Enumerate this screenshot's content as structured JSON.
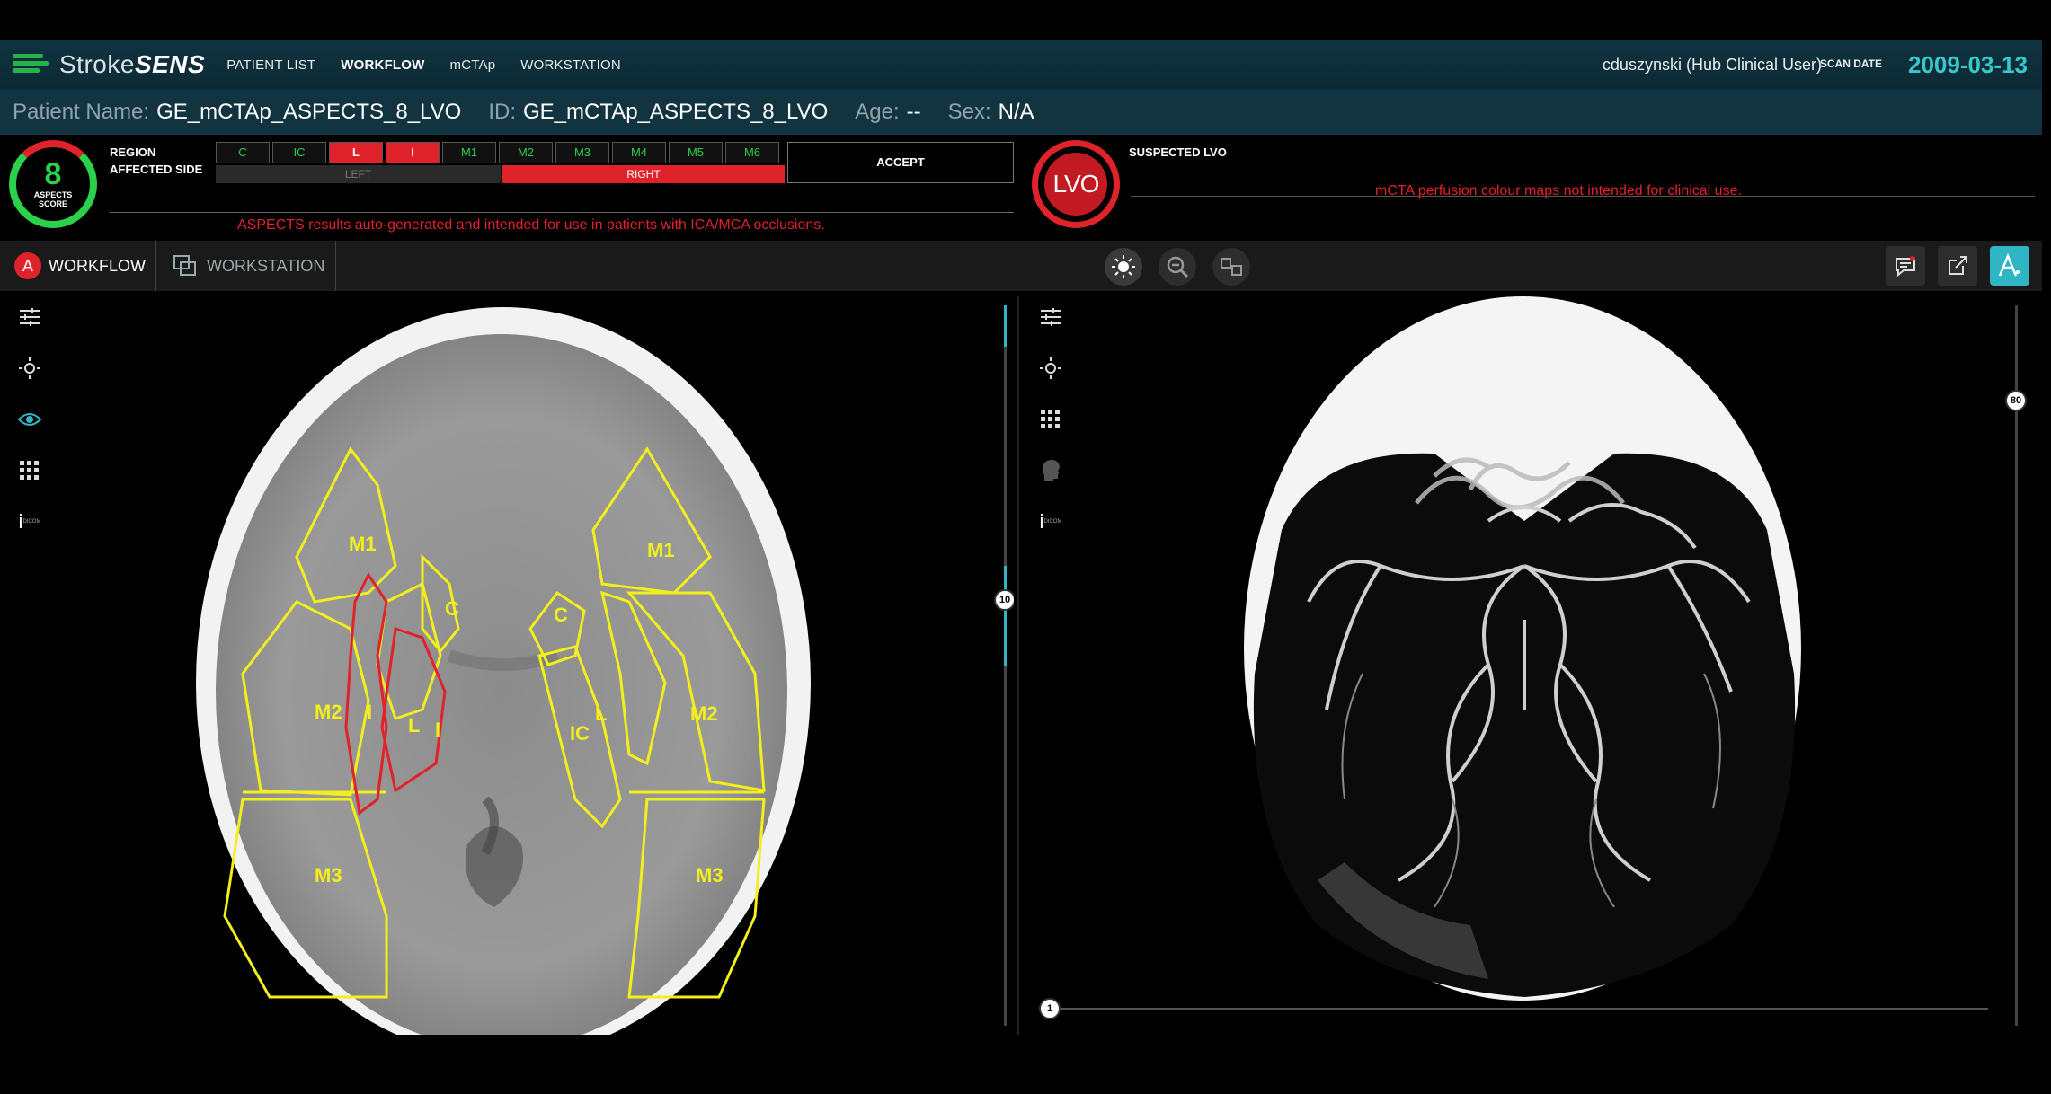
{
  "app": {
    "logo_prefix": "Stroke",
    "logo_suffix": "SENS",
    "nav": [
      "PATIENT LIST",
      "WORKFLOW",
      "mCTAp",
      "WORKSTATION"
    ],
    "user": "cduszynski (Hub Clinical User)",
    "scan_date_label": "SCAN DATE",
    "scan_date": "2009-03-13"
  },
  "patient": {
    "name_label": "Patient Name:",
    "name": "GE_mCTAp_ASPECTS_8_LVO",
    "id_label": "ID:",
    "id": "GE_mCTAp_ASPECTS_8_LVO",
    "age_label": "Age:",
    "age": "--",
    "sex_label": "Sex:",
    "sex": "N/A"
  },
  "aspects": {
    "score": "8",
    "score_label_1": "ASPECTS",
    "score_label_2": "SCORE",
    "region_label": "REGION",
    "affected_side_label": "AFFECTED SIDE",
    "regions": [
      {
        "label": "C",
        "affected": false
      },
      {
        "label": "IC",
        "affected": false
      },
      {
        "label": "L",
        "affected": true
      },
      {
        "label": "I",
        "affected": true
      },
      {
        "label": "M1",
        "affected": false
      },
      {
        "label": "M2",
        "affected": false
      },
      {
        "label": "M3",
        "affected": false
      },
      {
        "label": "M4",
        "affected": false
      },
      {
        "label": "M5",
        "affected": false
      },
      {
        "label": "M6",
        "affected": false
      }
    ],
    "side_left": "LEFT",
    "side_right": "RIGHT",
    "accept": "ACCEPT",
    "warning": "ASPECTS results auto-generated and intended for use in patients with ICA/MCA occlusions."
  },
  "lvo": {
    "badge": "LVO",
    "label": "SUSPECTED LVO",
    "warning": "mCTA perfusion colour maps not intended for clinical use."
  },
  "toolbar": {
    "workflow": "WORKFLOW",
    "workstation": "WORKSTATION"
  },
  "left_view": {
    "slice_number": "10",
    "regions_left_hemisphere": [
      "M1",
      "M2",
      "M3",
      "I",
      "L",
      "C",
      "I"
    ],
    "regions_right_hemisphere": [
      "M1",
      "M2",
      "M3",
      "C",
      "IC",
      "L"
    ],
    "tool_info_caption": "DICOM"
  },
  "right_view": {
    "slice_number": "80",
    "phase_number": "1",
    "tool_info_caption": "DICOM"
  },
  "colors": {
    "accent": "#2fb5c3",
    "affected": "#e0222b",
    "normal": "#2bd14a",
    "overlay": "#f2ef1c"
  }
}
